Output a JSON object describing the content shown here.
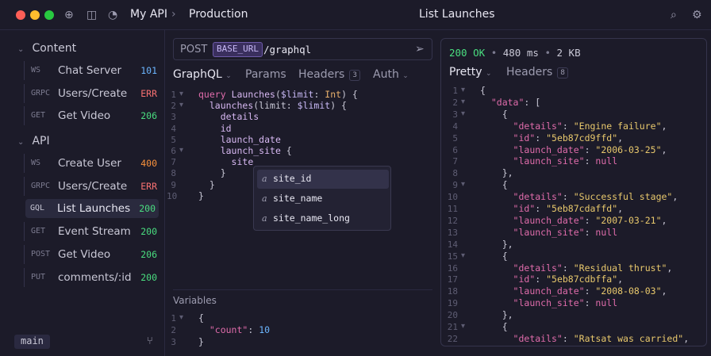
{
  "titlebar": {
    "workspace": "My API",
    "separator": "›",
    "environment": "Production",
    "request_title": "List Launches",
    "colors": {
      "close": "#ff5f57",
      "minimize": "#febc2e",
      "maximize": "#28c840"
    }
  },
  "sidebar": {
    "folders": [
      {
        "label": "Content",
        "chevron": "⌄"
      },
      {
        "label": "API",
        "chevron": "⌄"
      }
    ],
    "content_items": [
      {
        "method": "WS",
        "name": "Chat Server",
        "code": "101",
        "color": "#6cb6ff"
      },
      {
        "method": "GRPC",
        "name": "Users/Create",
        "code": "ERR",
        "color": "#f87171"
      },
      {
        "method": "GET",
        "name": "Get Video",
        "code": "206",
        "color": "#4ade80"
      }
    ],
    "api_items": [
      {
        "method": "WS",
        "name": "Create User",
        "code": "400",
        "color": "#fb923c"
      },
      {
        "method": "GRPC",
        "name": "Users/Create",
        "code": "ERR",
        "color": "#f87171"
      },
      {
        "method": "GQL",
        "name": "List Launches",
        "code": "200",
        "color": "#4ade80"
      },
      {
        "method": "GET",
        "name": "Event Stream",
        "code": "200",
        "color": "#4ade80"
      },
      {
        "method": "POST",
        "name": "Get Video",
        "code": "206",
        "color": "#4ade80"
      },
      {
        "method": "PUT",
        "name": "comments/:id",
        "code": "200",
        "color": "#4ade80"
      }
    ],
    "branch": "main"
  },
  "request": {
    "method": "POST",
    "base_var": "BASE_URL",
    "path": "/graphql",
    "tabs": [
      {
        "label": "GraphQL",
        "chevron": "⌄"
      },
      {
        "label": "Params"
      },
      {
        "label": "Headers",
        "badge": "3"
      },
      {
        "label": "Auth",
        "chevron": "⌄"
      }
    ],
    "query_lines": [
      "query Launches($limit: Int) {",
      "  launches(limit: $limit) {",
      "    details",
      "    id",
      "    launch_date",
      "    launch_site {",
      "      site",
      "    }",
      "  }",
      "}"
    ],
    "autocomplete": [
      "site_id",
      "site_name",
      "site_name_long"
    ],
    "autocomplete_kind": "a",
    "variables_label": "Variables",
    "variables_lines": [
      "{",
      "  \"count\": 10",
      "}"
    ]
  },
  "response": {
    "status": "200 OK",
    "time": "480 ms",
    "size": "2 KB",
    "bullet": "•",
    "tabs": [
      {
        "label": "Pretty",
        "chevron": "⌄"
      },
      {
        "label": "Headers",
        "badge": "8"
      }
    ],
    "lines": [
      "{",
      "  \"data\": [",
      "    {",
      "      \"details\": \"Engine failure\",",
      "      \"id\": \"5eb87cd9ffd\",",
      "      \"launch_date\": \"2006-03-25\",",
      "      \"launch_site\": null",
      "    },",
      "    {",
      "      \"details\": \"Successful stage\",",
      "      \"id\": \"5eb87cdaffd\",",
      "      \"launch_date\": \"2007-03-21\",",
      "      \"launch_site\": null",
      "    },",
      "    {",
      "      \"details\": \"Residual thrust\",",
      "      \"id\": \"5eb87cdbffa\",",
      "      \"launch_date\": \"2008-08-03\",",
      "      \"launch_site\": null",
      "    },",
      "    {",
      "      \"details\": \"Ratsat was carried\","
    ]
  }
}
